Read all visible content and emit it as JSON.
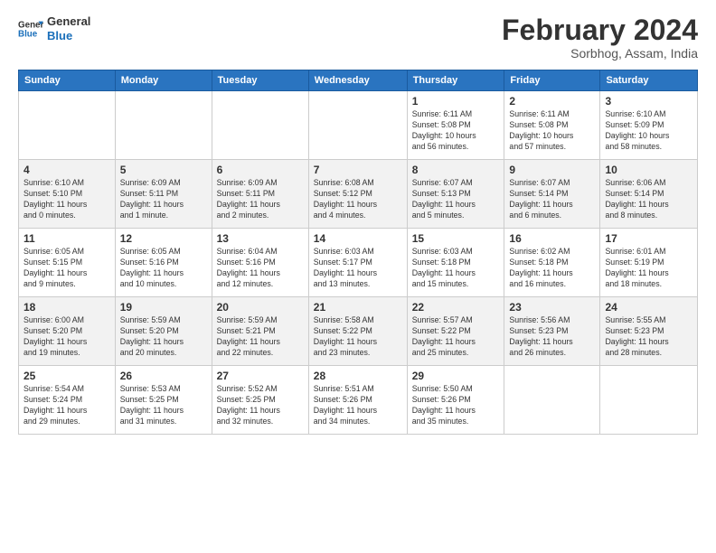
{
  "logo": {
    "line1": "General",
    "line2": "Blue"
  },
  "title": "February 2024",
  "subtitle": "Sorbhog, Assam, India",
  "header": {
    "days": [
      "Sunday",
      "Monday",
      "Tuesday",
      "Wednesday",
      "Thursday",
      "Friday",
      "Saturday"
    ]
  },
  "weeks": [
    [
      {
        "num": "",
        "info": ""
      },
      {
        "num": "",
        "info": ""
      },
      {
        "num": "",
        "info": ""
      },
      {
        "num": "",
        "info": ""
      },
      {
        "num": "1",
        "info": "Sunrise: 6:11 AM\nSunset: 5:08 PM\nDaylight: 10 hours\nand 56 minutes."
      },
      {
        "num": "2",
        "info": "Sunrise: 6:11 AM\nSunset: 5:08 PM\nDaylight: 10 hours\nand 57 minutes."
      },
      {
        "num": "3",
        "info": "Sunrise: 6:10 AM\nSunset: 5:09 PM\nDaylight: 10 hours\nand 58 minutes."
      }
    ],
    [
      {
        "num": "4",
        "info": "Sunrise: 6:10 AM\nSunset: 5:10 PM\nDaylight: 11 hours\nand 0 minutes."
      },
      {
        "num": "5",
        "info": "Sunrise: 6:09 AM\nSunset: 5:11 PM\nDaylight: 11 hours\nand 1 minute."
      },
      {
        "num": "6",
        "info": "Sunrise: 6:09 AM\nSunset: 5:11 PM\nDaylight: 11 hours\nand 2 minutes."
      },
      {
        "num": "7",
        "info": "Sunrise: 6:08 AM\nSunset: 5:12 PM\nDaylight: 11 hours\nand 4 minutes."
      },
      {
        "num": "8",
        "info": "Sunrise: 6:07 AM\nSunset: 5:13 PM\nDaylight: 11 hours\nand 5 minutes."
      },
      {
        "num": "9",
        "info": "Sunrise: 6:07 AM\nSunset: 5:14 PM\nDaylight: 11 hours\nand 6 minutes."
      },
      {
        "num": "10",
        "info": "Sunrise: 6:06 AM\nSunset: 5:14 PM\nDaylight: 11 hours\nand 8 minutes."
      }
    ],
    [
      {
        "num": "11",
        "info": "Sunrise: 6:05 AM\nSunset: 5:15 PM\nDaylight: 11 hours\nand 9 minutes."
      },
      {
        "num": "12",
        "info": "Sunrise: 6:05 AM\nSunset: 5:16 PM\nDaylight: 11 hours\nand 10 minutes."
      },
      {
        "num": "13",
        "info": "Sunrise: 6:04 AM\nSunset: 5:16 PM\nDaylight: 11 hours\nand 12 minutes."
      },
      {
        "num": "14",
        "info": "Sunrise: 6:03 AM\nSunset: 5:17 PM\nDaylight: 11 hours\nand 13 minutes."
      },
      {
        "num": "15",
        "info": "Sunrise: 6:03 AM\nSunset: 5:18 PM\nDaylight: 11 hours\nand 15 minutes."
      },
      {
        "num": "16",
        "info": "Sunrise: 6:02 AM\nSunset: 5:18 PM\nDaylight: 11 hours\nand 16 minutes."
      },
      {
        "num": "17",
        "info": "Sunrise: 6:01 AM\nSunset: 5:19 PM\nDaylight: 11 hours\nand 18 minutes."
      }
    ],
    [
      {
        "num": "18",
        "info": "Sunrise: 6:00 AM\nSunset: 5:20 PM\nDaylight: 11 hours\nand 19 minutes."
      },
      {
        "num": "19",
        "info": "Sunrise: 5:59 AM\nSunset: 5:20 PM\nDaylight: 11 hours\nand 20 minutes."
      },
      {
        "num": "20",
        "info": "Sunrise: 5:59 AM\nSunset: 5:21 PM\nDaylight: 11 hours\nand 22 minutes."
      },
      {
        "num": "21",
        "info": "Sunrise: 5:58 AM\nSunset: 5:22 PM\nDaylight: 11 hours\nand 23 minutes."
      },
      {
        "num": "22",
        "info": "Sunrise: 5:57 AM\nSunset: 5:22 PM\nDaylight: 11 hours\nand 25 minutes."
      },
      {
        "num": "23",
        "info": "Sunrise: 5:56 AM\nSunset: 5:23 PM\nDaylight: 11 hours\nand 26 minutes."
      },
      {
        "num": "24",
        "info": "Sunrise: 5:55 AM\nSunset: 5:23 PM\nDaylight: 11 hours\nand 28 minutes."
      }
    ],
    [
      {
        "num": "25",
        "info": "Sunrise: 5:54 AM\nSunset: 5:24 PM\nDaylight: 11 hours\nand 29 minutes."
      },
      {
        "num": "26",
        "info": "Sunrise: 5:53 AM\nSunset: 5:25 PM\nDaylight: 11 hours\nand 31 minutes."
      },
      {
        "num": "27",
        "info": "Sunrise: 5:52 AM\nSunset: 5:25 PM\nDaylight: 11 hours\nand 32 minutes."
      },
      {
        "num": "28",
        "info": "Sunrise: 5:51 AM\nSunset: 5:26 PM\nDaylight: 11 hours\nand 34 minutes."
      },
      {
        "num": "29",
        "info": "Sunrise: 5:50 AM\nSunset: 5:26 PM\nDaylight: 11 hours\nand 35 minutes."
      },
      {
        "num": "",
        "info": ""
      },
      {
        "num": "",
        "info": ""
      }
    ]
  ]
}
